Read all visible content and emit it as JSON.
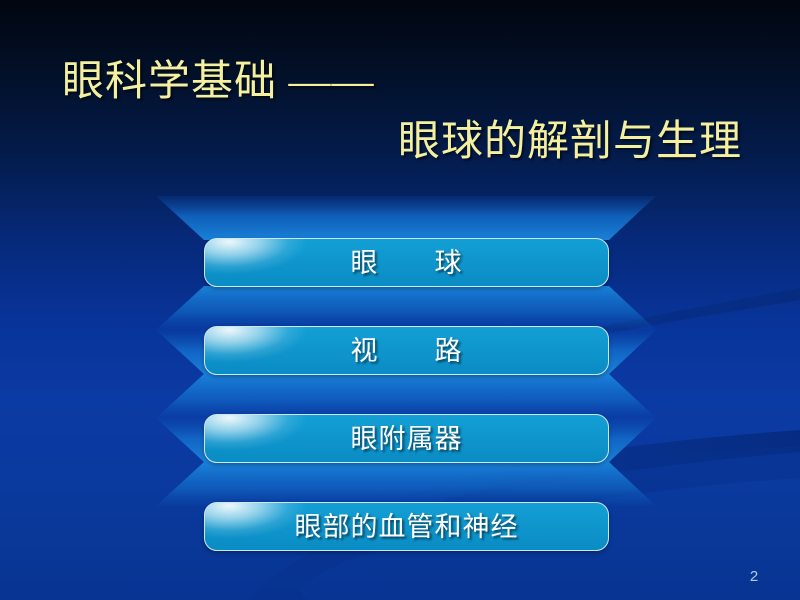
{
  "slide": {
    "background": {
      "top_color": "#010610",
      "bottom_color": "#083493",
      "accent_color": "#0f96cd",
      "title_color": "#f4f0a0",
      "button_border_color": "#cfe6f5",
      "button_text_color": "#ffffff",
      "page_number_color": "#b9c9ec"
    },
    "title": {
      "line1": "眼科学基础 ——",
      "line2": "眼球的解剖与生理"
    },
    "menu_buttons": [
      {
        "label": "眼　　球"
      },
      {
        "label": "视　　路"
      },
      {
        "label": "眼附属器"
      },
      {
        "label": "眼部的血管和神经"
      }
    ],
    "page_number": "2"
  }
}
